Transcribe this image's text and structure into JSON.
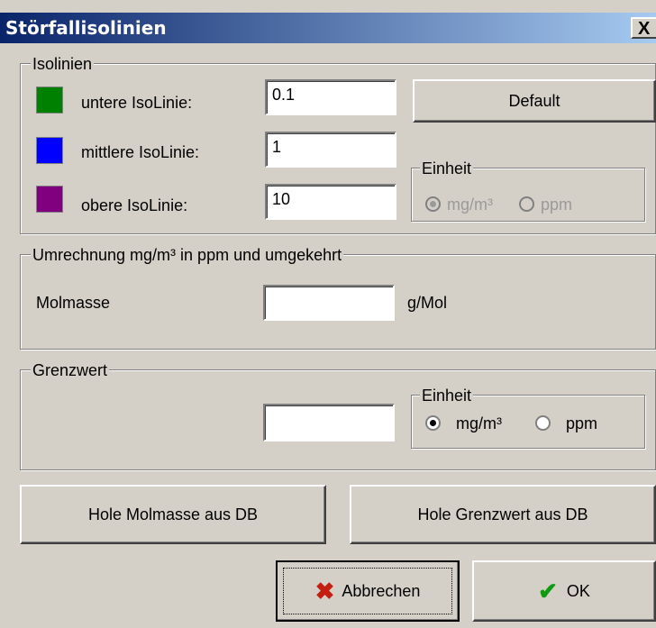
{
  "window": {
    "title": "Störfallisolinien",
    "close_glyph": "X"
  },
  "isolinien": {
    "legend": "Isolinien",
    "rows": [
      {
        "label": "untere IsoLinie:",
        "value": "0.1",
        "color": "#008000"
      },
      {
        "label": "mittlere IsoLinie:",
        "value": "1",
        "color": "#0000ff"
      },
      {
        "label": "obere IsoLinie:",
        "value": "10",
        "color": "#800080"
      }
    ],
    "default_button": "Default",
    "einheit": {
      "legend": "Einheit",
      "option1": "mg/m³",
      "option2": "ppm",
      "selected": "mg/m³",
      "enabled": false
    }
  },
  "umrechnung": {
    "legend": "Umrechnung mg/m³ in ppm und umgekehrt",
    "molmasse_label": "Molmasse",
    "molmasse_value": "",
    "unit": "g/Mol"
  },
  "grenzwert": {
    "legend": "Grenzwert",
    "value": "",
    "einheit": {
      "legend": "Einheit",
      "option1": "mg/m³",
      "option2": "ppm",
      "selected": "mg/m³",
      "enabled": true
    }
  },
  "buttons": {
    "hole_molmasse": "Hole Molmasse aus DB",
    "hole_grenzwert": "Hole Grenzwert aus DB",
    "abbrechen": "Abbrechen",
    "ok": "OK"
  }
}
